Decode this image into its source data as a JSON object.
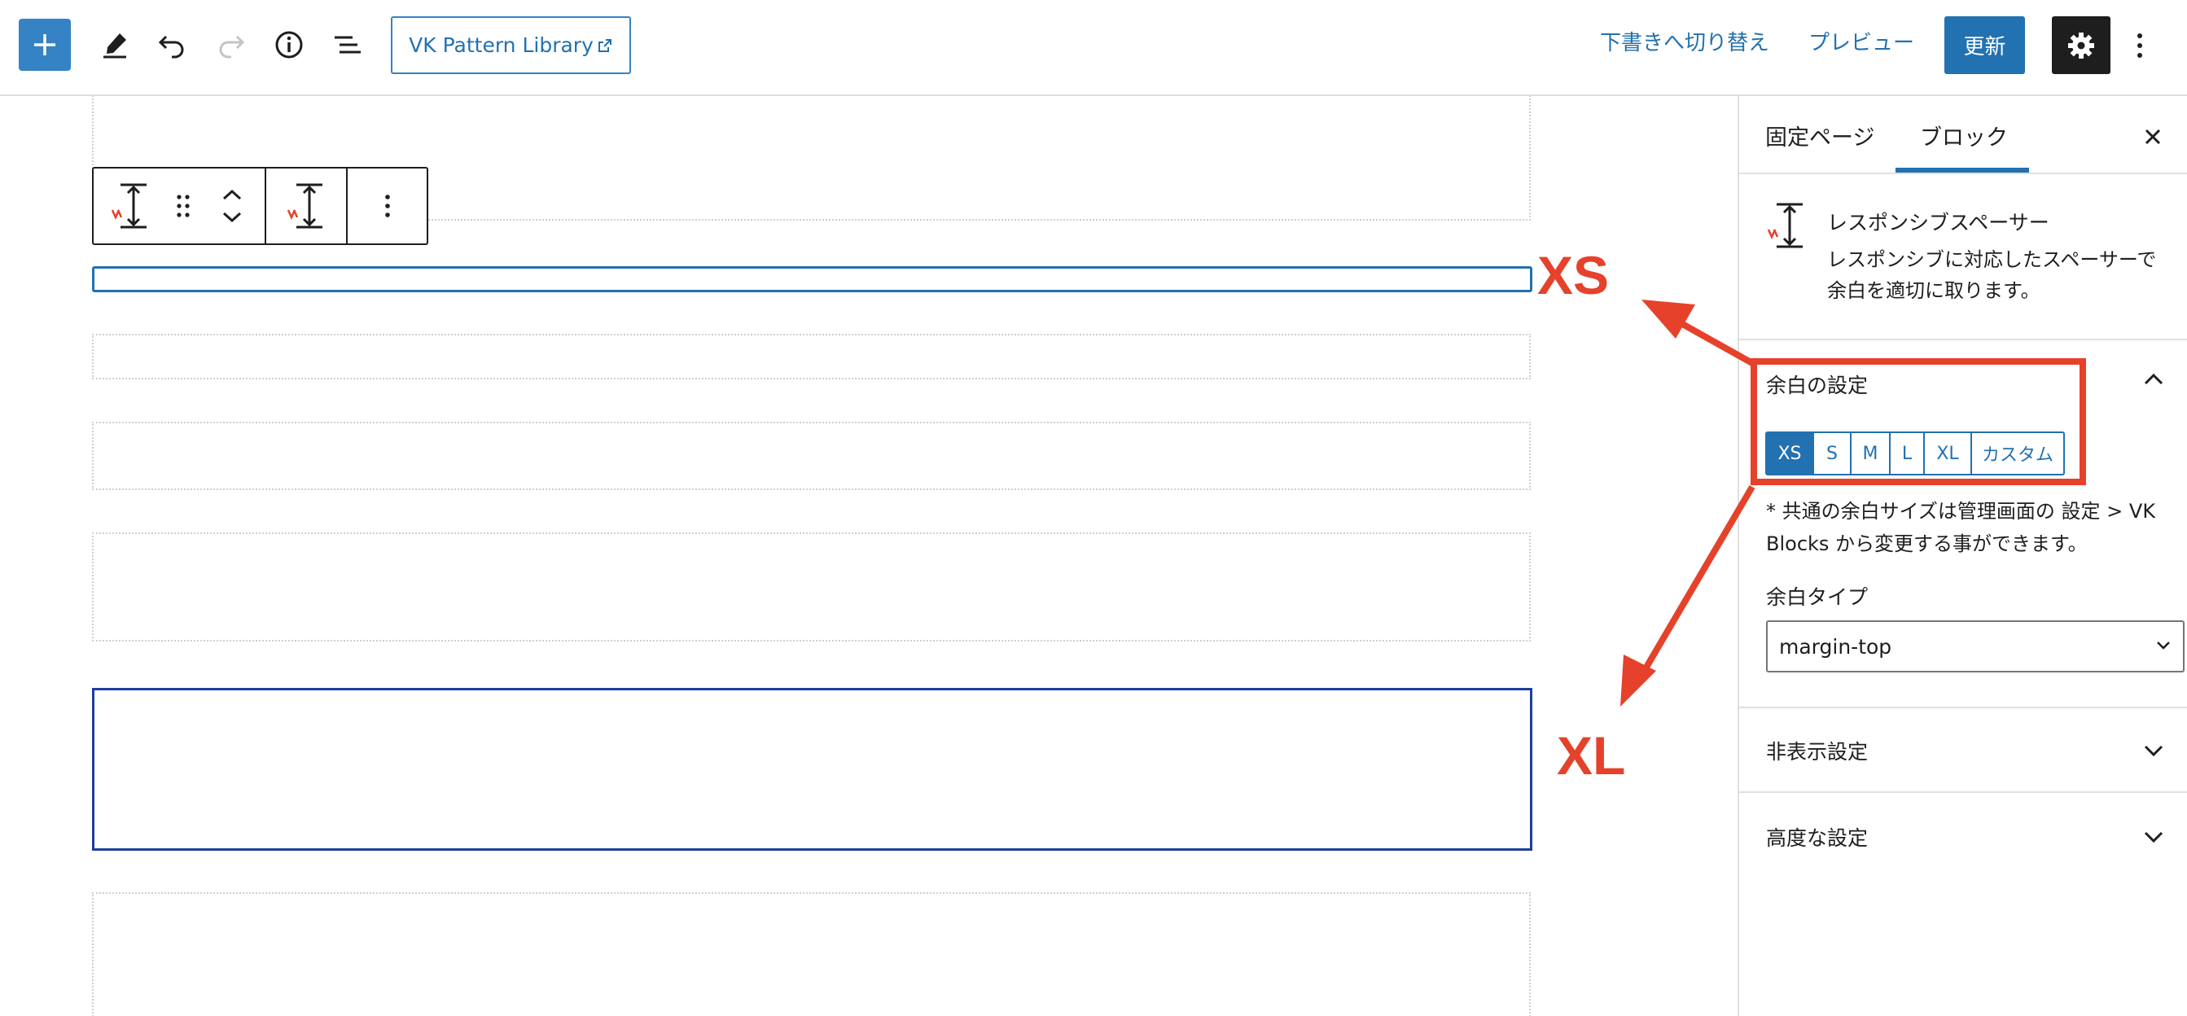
{
  "topbar": {
    "add_icon": "plus-icon",
    "tools_icon": "pencil-icon",
    "undo_icon": "undo-icon",
    "redo_icon": "redo-icon",
    "info_icon": "info-icon",
    "list_view_icon": "list-view-icon",
    "pattern_library_label": "VK Pattern Library",
    "switch_to_draft_label": "下書きへ切り替え",
    "preview_label": "プレビュー",
    "update_label": "更新",
    "settings_icon": "gear-icon",
    "options_icon": "vertical-ellipsis-icon"
  },
  "sidebar": {
    "tabs": [
      {
        "label": "固定ページ"
      },
      {
        "label": "ブロック",
        "active": true
      }
    ],
    "block_card": {
      "title": "レスポンシブスペーサー",
      "description": "レスポンシブに対応したスペーサーで余白を適切に取ります。"
    },
    "spacing_panel": {
      "title": "余白の設定",
      "sizes": [
        "XS",
        "S",
        "M",
        "L",
        "XL",
        "カスタム"
      ],
      "selected_size": "XS",
      "help": "* 共通の余白サイズは管理画面の 設定 > VK Blocks から変更する事ができます。",
      "type_label": "余白タイプ",
      "type_value": "margin-top"
    },
    "hidden_panel_title": "非表示設定",
    "advanced_panel_title": "高度な設定"
  },
  "annotations": {
    "xs": "XS",
    "xl": "XL",
    "color": "#e6412a"
  },
  "colors": {
    "accent": "#2271b1",
    "dark": "#1e1e1e"
  }
}
